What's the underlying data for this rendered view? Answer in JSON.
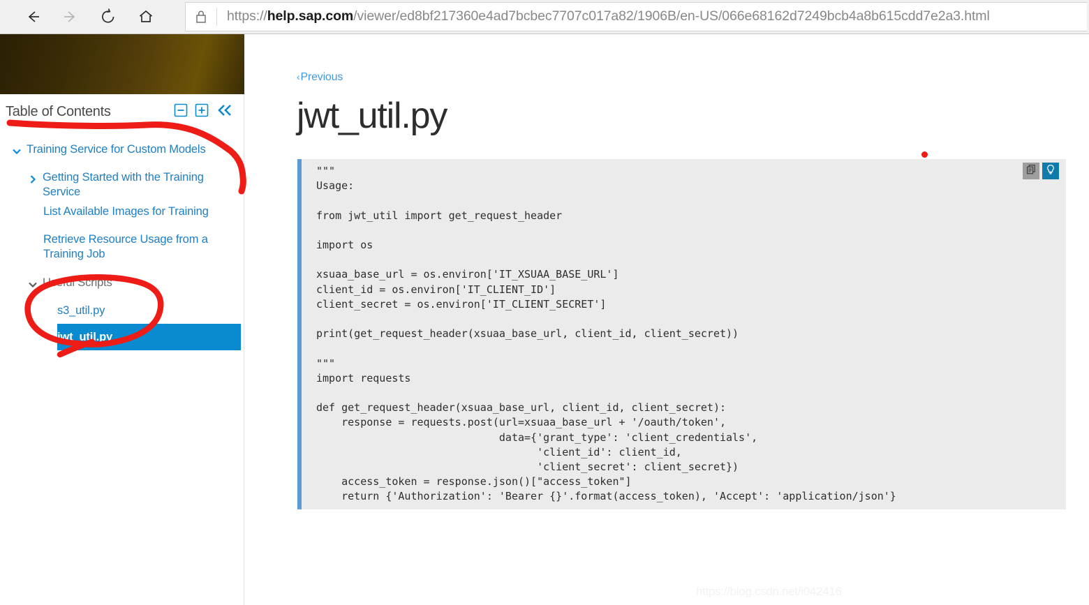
{
  "browser": {
    "back_label": "Back",
    "forward_label": "Forward",
    "reload_label": "Refresh",
    "home_label": "Home",
    "url_full": "https://help.sap.com/viewer/ed8bf217360e4ad7bcbec7707c017a82/1906B/en-US/066e68162d7249bcb4a8b615cdd7e2a3.html",
    "url_scheme": "https://",
    "url_domain": "help.sap.com",
    "url_path": "/viewer/ed8bf217360e4ad7bcbec7707c017a82/1906B/en-US/066e68162d7249bcb4a8b615cdd7e2a3.html"
  },
  "sidebar": {
    "toc_title": "Table of Contents",
    "collapse_all_label": "Collapse All",
    "expand_all_label": "Expand All",
    "hide_panel_label": "Hide Table of Contents",
    "items": [
      {
        "label": "Training Service for Custom Models",
        "level": 1,
        "state": "expanded",
        "kind": "link",
        "selected": false
      },
      {
        "label": "Getting Started with the Training Service",
        "level": 2,
        "state": "collapsed",
        "kind": "link",
        "selected": false
      },
      {
        "label": "List Available Images for Training",
        "level": 2,
        "state": "leaf",
        "kind": "link",
        "selected": false
      },
      {
        "label": "Retrieve Resource Usage from a Training Job",
        "level": 2,
        "state": "leaf",
        "kind": "link",
        "selected": false
      },
      {
        "label": "Useful Scripts",
        "level": 2,
        "state": "expanded",
        "kind": "plain",
        "selected": false
      },
      {
        "label": "s3_util.py",
        "level": 3,
        "state": "leaf",
        "kind": "link",
        "selected": false
      },
      {
        "label": "jwt_util.py",
        "level": 3,
        "state": "leaf",
        "kind": "link",
        "selected": true
      }
    ]
  },
  "main": {
    "previous_label": "Previous",
    "previous_chevron": "‹",
    "page_title": "jwt_util.py",
    "copy_button_label": "Copy to clipboard",
    "tip_button_label": "Show tip",
    "code": "\"\"\"\nUsage:\n\nfrom jwt_util import get_request_header\n\nimport os\n\nxsuaa_base_url = os.environ['IT_XSUAA_BASE_URL']\nclient_id = os.environ['IT_CLIENT_ID']\nclient_secret = os.environ['IT_CLIENT_SECRET']\n\nprint(get_request_header(xsuaa_base_url, client_id, client_secret))\n\n\"\"\"\nimport requests\n\ndef get_request_header(xsuaa_base_url, client_id, client_secret):\n    response = requests.post(url=xsuaa_base_url + '/oauth/token',\n                             data={'grant_type': 'client_credentials',\n                                   'client_id': client_id,\n                                   'client_secret': client_secret})\n    access_token = response.json()[\"access_token\"]\n    return {'Authorization': 'Bearer {}'.format(access_token), 'Accept': 'application/json'}"
  },
  "watermark": "https://blog.csdn.net/i042416",
  "colors": {
    "link_blue": "#1f7fc1",
    "selected_blue": "#0a8ad0",
    "code_bg": "#ebebeb",
    "code_accent": "#5b9bd5",
    "annotation_red": "#ee1c16",
    "tip_button_blue": "#0f7bab",
    "copy_button_gray": "#9e9e9e"
  },
  "annotations": {
    "underline_note": "red hand-drawn stroke under Table of Contents curving down past tree",
    "circle_note": "red hand-drawn ellipse around s3_util.py and jwt_util.py",
    "dot_note": "small red dot right of page title"
  }
}
